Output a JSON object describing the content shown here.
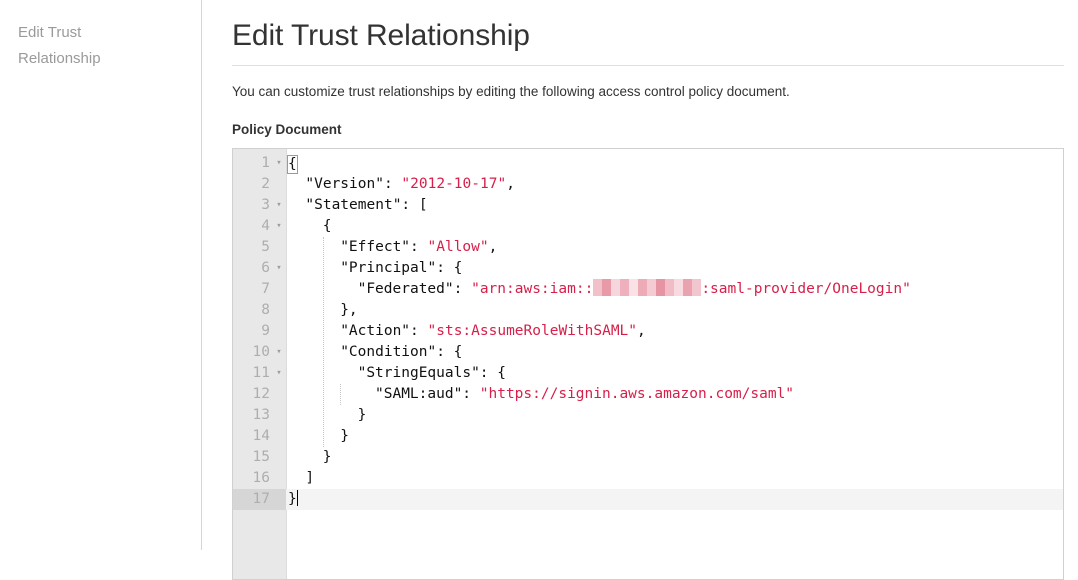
{
  "sidebar": {
    "items": [
      {
        "label": "Edit Trust Relationship"
      }
    ]
  },
  "page": {
    "title": "Edit Trust Relationship",
    "description": "You can customize trust relationships by editing the following access control policy document.",
    "field_label": "Policy Document"
  },
  "colors": {
    "string_red": "#d6204a",
    "text_black": "#111111",
    "gutter_bg": "#e8e8e8",
    "gutter_number": "#aeaeae",
    "active_line_bg": "#f4f4f4",
    "active_gutter_bg": "#d6d6d6",
    "sidebar_text": "#9a9a9a",
    "redaction_pink": "#efa9b4"
  },
  "editor": {
    "active_line": 17,
    "total_lines": 17,
    "fold_arrow_glyph": "▾",
    "fold_lines": [
      1,
      3,
      4,
      6,
      10,
      11
    ],
    "redaction_label": "redacted-account-id",
    "lines": [
      {
        "n": 1,
        "indent": 0,
        "tokens": [
          {
            "t": "bracket",
            "v": "{"
          }
        ]
      },
      {
        "n": 2,
        "indent": 2,
        "tokens": [
          {
            "t": "key",
            "v": "\"Version\": "
          },
          {
            "t": "str",
            "v": "\"2012-10-17\""
          },
          {
            "t": "key",
            "v": ","
          }
        ]
      },
      {
        "n": 3,
        "indent": 2,
        "tokens": [
          {
            "t": "key",
            "v": "\"Statement\": ["
          }
        ]
      },
      {
        "n": 4,
        "indent": 4,
        "tokens": [
          {
            "t": "key",
            "v": "{"
          }
        ]
      },
      {
        "n": 5,
        "indent": 6,
        "tokens": [
          {
            "t": "key",
            "v": "\"Effect\": "
          },
          {
            "t": "str",
            "v": "\"Allow\""
          },
          {
            "t": "key",
            "v": ","
          }
        ]
      },
      {
        "n": 6,
        "indent": 6,
        "tokens": [
          {
            "t": "key",
            "v": "\"Principal\": {"
          }
        ]
      },
      {
        "n": 7,
        "indent": 8,
        "tokens": [
          {
            "t": "key",
            "v": "\"Federated\": "
          },
          {
            "t": "str",
            "v": "\"arn:aws:iam::"
          },
          {
            "t": "redact",
            "v": ""
          },
          {
            "t": "str",
            "v": ":saml-provider/OneLogin\""
          }
        ]
      },
      {
        "n": 8,
        "indent": 6,
        "tokens": [
          {
            "t": "key",
            "v": "},"
          }
        ]
      },
      {
        "n": 9,
        "indent": 6,
        "tokens": [
          {
            "t": "key",
            "v": "\"Action\": "
          },
          {
            "t": "str",
            "v": "\"sts:AssumeRoleWithSAML\""
          },
          {
            "t": "key",
            "v": ","
          }
        ]
      },
      {
        "n": 10,
        "indent": 6,
        "tokens": [
          {
            "t": "key",
            "v": "\"Condition\": {"
          }
        ]
      },
      {
        "n": 11,
        "indent": 8,
        "tokens": [
          {
            "t": "key",
            "v": "\"StringEquals\": {"
          }
        ]
      },
      {
        "n": 12,
        "indent": 10,
        "tokens": [
          {
            "t": "key",
            "v": "\"SAML:aud\": "
          },
          {
            "t": "str",
            "v": "\"https://signin.aws.amazon.com/saml\""
          }
        ]
      },
      {
        "n": 13,
        "indent": 8,
        "tokens": [
          {
            "t": "key",
            "v": "}"
          }
        ]
      },
      {
        "n": 14,
        "indent": 6,
        "tokens": [
          {
            "t": "key",
            "v": "}"
          }
        ]
      },
      {
        "n": 15,
        "indent": 4,
        "tokens": [
          {
            "t": "key",
            "v": "}"
          }
        ]
      },
      {
        "n": 16,
        "indent": 2,
        "tokens": [
          {
            "t": "key",
            "v": "]"
          }
        ]
      },
      {
        "n": 17,
        "indent": 0,
        "tokens": [
          {
            "t": "key",
            "v": "}"
          },
          {
            "t": "caret",
            "v": ""
          }
        ]
      }
    ],
    "indent_guides": [
      {
        "col": 4,
        "from_line": 5,
        "to_line": 14
      },
      {
        "col": 6,
        "from_line": 12,
        "to_line": 12
      }
    ]
  }
}
